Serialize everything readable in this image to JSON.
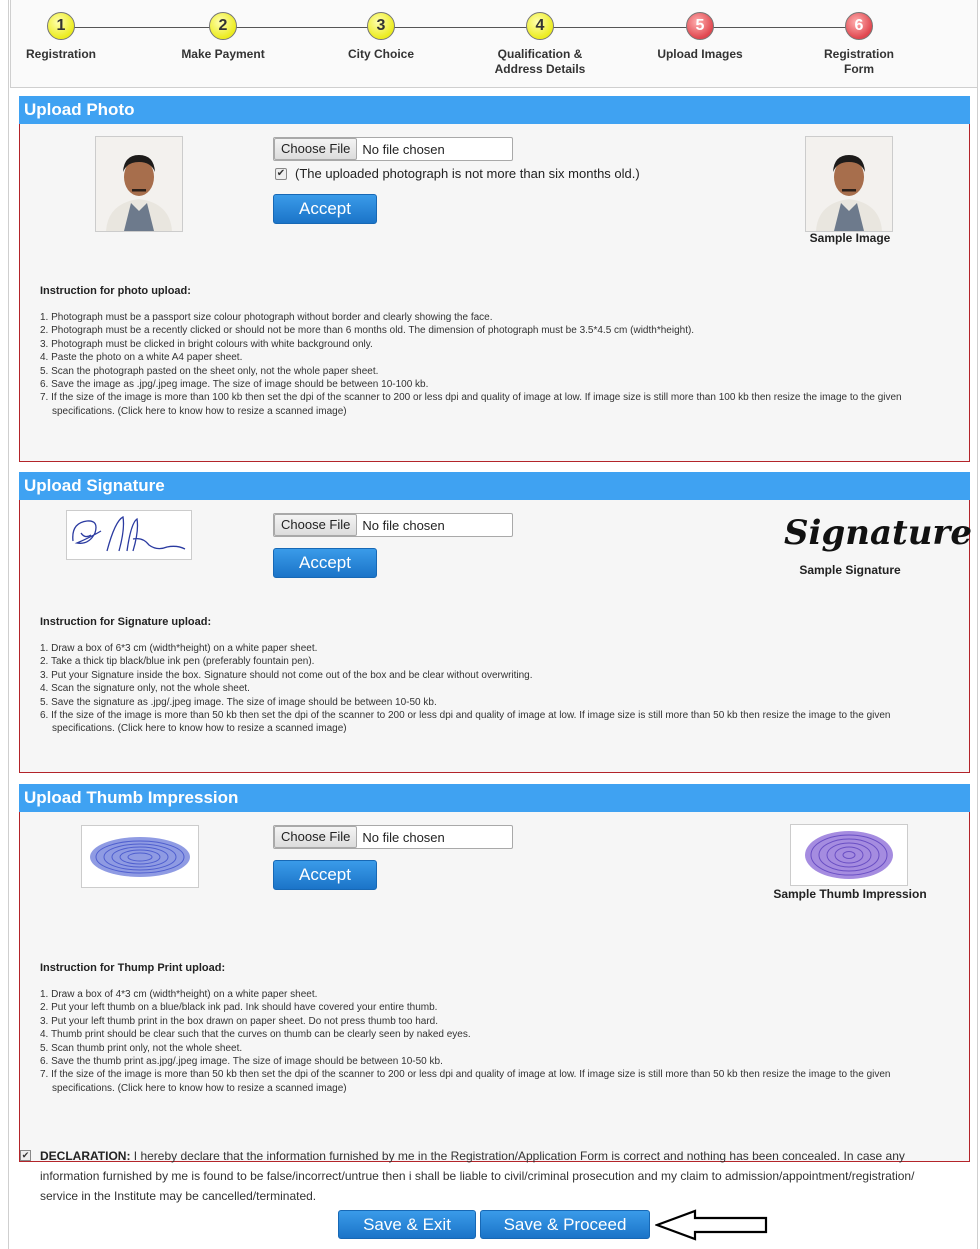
{
  "stepper": {
    "steps": [
      {
        "number": "1",
        "label": "Registration",
        "color": "yellow"
      },
      {
        "number": "2",
        "label": "Make Payment",
        "color": "yellow"
      },
      {
        "number": "3",
        "label": "City Choice",
        "color": "yellow"
      },
      {
        "number": "4",
        "label_line1": "Qualification &",
        "label_line2": "Address Details",
        "color": "yellow"
      },
      {
        "number": "5",
        "label": "Upload Images",
        "color": "red"
      },
      {
        "number": "6",
        "label_line1": "Registration",
        "label_line2": "Form",
        "color": "red"
      }
    ]
  },
  "photo": {
    "title": "Upload Photo",
    "choose_file": "Choose File",
    "no_file": "No file chosen",
    "confirm_text": "(The uploaded photograph is not more than six months old.)",
    "accept": "Accept",
    "sample_label": "Sample Image",
    "instr_title": "Instruction for photo upload:",
    "instructions": [
      "1. Photograph must be a passport size colour photograph without border and clearly showing the face.",
      "2. Photograph must be a recently clicked or should not be more than 6 months old. The dimension of photograph must be 3.5*4.5 cm (width*height).",
      "3. Photograph must be clicked in bright colours with white background only.",
      "4. Paste the photo on a white A4 paper sheet.",
      "5. Scan the photograph pasted on the sheet only, not the whole paper sheet.",
      "6. Save the image as .jpg/.jpeg image. The size of image should be between 10-100 kb.",
      "7. If the size of the image is more than 100 kb then set the dpi of the scanner to 200 or less dpi and quality of image at low. If image size is still more than 100 kb then resize the image to the given specifications. (Click here to know how to resize a scanned image)"
    ]
  },
  "signature": {
    "title": "Upload Signature",
    "choose_file": "Choose File",
    "no_file": "No file chosen",
    "accept": "Accept",
    "sample_text": "Signature",
    "sample_label": "Sample Signature",
    "instr_title": "Instruction for Signature upload:",
    "instructions": [
      "1. Draw a box of 6*3 cm (width*height) on a white paper sheet.",
      "2. Take a thick tip black/blue ink pen (preferably fountain pen).",
      "3. Put your Signature inside the box. Signature should not come out of the box and be clear without overwriting.",
      "4. Scan the signature only, not the whole sheet.",
      "5. Save the signature as .jpg/.jpeg image. The size of image should be between 10-50 kb.",
      "6. If the size of the image is more than 50 kb then set the dpi of the scanner to 200 or less dpi and quality of image at low. If image size is still more than 50 kb then resize the image to the given specifications. (Click here to know how to resize a scanned image)"
    ]
  },
  "thumb": {
    "title": "Upload Thumb Impression",
    "choose_file": "Choose File",
    "no_file": "No file chosen",
    "accept": "Accept",
    "sample_label": "Sample Thumb Impression",
    "instr_title": "Instruction for Thump Print upload:",
    "instructions": [
      "1. Draw a box of 4*3 cm (width*height) on a white paper sheet.",
      "2. Put your left thumb on a blue/black ink pad. Ink should have covered your entire thumb.",
      "3. Put your left thumb print in the box drawn on paper sheet. Do not press thumb too hard.",
      "4. Thumb print should be clear such that the curves on thumb can be clearly seen by naked eyes.",
      "5. Scan thumb print only, not the whole sheet.",
      "6. Save the thumb print as.jpg/.jpeg image. The size of image should be between 10-50 kb.",
      "7. If the size of the image is more than 50 kb then set the dpi of the scanner to 200 or less dpi and quality of image at low. If image size is still more than 50 kb then resize the image to the given specifications. (Click here to know how to resize a scanned image)"
    ]
  },
  "declaration": {
    "label": "DECLARATION:",
    "text": " I hereby declare that the information furnished by me in the Registration/Application Form is correct and nothing has been concealed. In case any information furnished by me is found to be false/incorrect/untrue then i shall be liable to civil/criminal prosecution and my claim to admission/appointment/registration/ service in the Institute may be cancelled/terminated."
  },
  "actions": {
    "save_exit": "Save & Exit",
    "save_proceed": "Save & Proceed"
  },
  "colors": {
    "header_blue": "#3fa2f2",
    "button_blue": "#1b74c8",
    "border_red": "#b3242a"
  }
}
